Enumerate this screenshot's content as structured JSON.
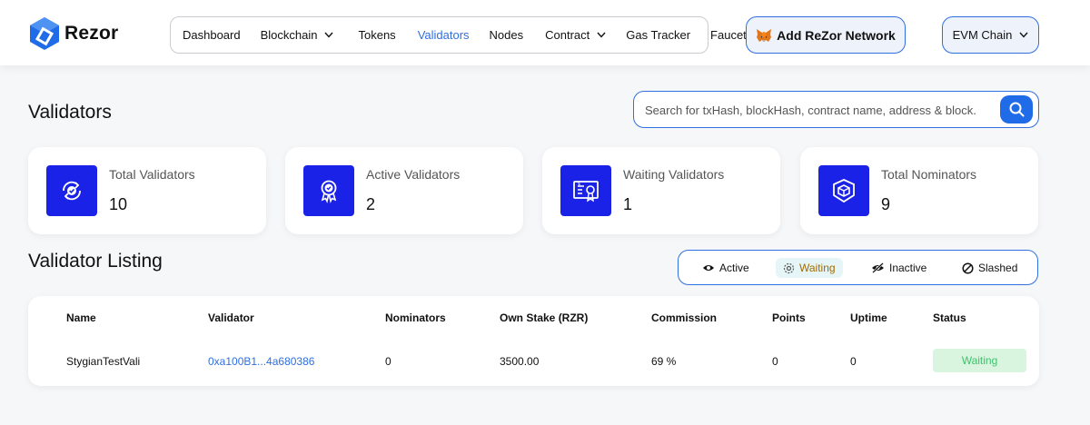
{
  "app": {
    "logo_text": "Rezor",
    "brand_color": "#1a22e8",
    "accent_color": "#2f6fe0"
  },
  "nav": {
    "items": [
      {
        "label": "Dashboard",
        "has_dropdown": false,
        "active": false
      },
      {
        "label": "Blockchain",
        "has_dropdown": true,
        "active": false
      },
      {
        "label": "Tokens",
        "has_dropdown": false,
        "active": false
      },
      {
        "label": "Validators",
        "has_dropdown": false,
        "active": true
      },
      {
        "label": "Nodes",
        "has_dropdown": false,
        "active": false
      },
      {
        "label": "Contract",
        "has_dropdown": true,
        "active": false
      },
      {
        "label": "Gas Tracker",
        "has_dropdown": false,
        "active": false
      },
      {
        "label": "Faucet",
        "has_dropdown": false,
        "active": false
      }
    ],
    "add_network_label": "Add ReZor Network",
    "chain_select": "EVM Chain"
  },
  "page": {
    "title": "Validators"
  },
  "search": {
    "placeholder": "Search for txHash, blockHash, contract name, address & block.",
    "icon": "search-icon"
  },
  "stats": [
    {
      "label": "Total Validators",
      "value": "10",
      "icon": "refresh-check-icon"
    },
    {
      "label": "Active Validators",
      "value": "2",
      "icon": "award-badge-icon"
    },
    {
      "label": "Waiting Validators",
      "value": "1",
      "icon": "certificate-icon"
    },
    {
      "label": "Total Nominators",
      "value": "9",
      "icon": "cube-shield-icon"
    }
  ],
  "listing": {
    "title": "Validator Listing",
    "filters": [
      {
        "label": "Active",
        "icon": "eye-icon",
        "selected": false
      },
      {
        "label": "Waiting",
        "icon": "target-icon",
        "selected": true
      },
      {
        "label": "Inactive",
        "icon": "eye-off-icon",
        "selected": false
      },
      {
        "label": "Slashed",
        "icon": "ban-icon",
        "selected": false
      }
    ],
    "columns": [
      "Name",
      "Validator",
      "Nominators",
      "Own Stake (RZR)",
      "Commission",
      "Points",
      "Uptime",
      "Status"
    ],
    "rows": [
      {
        "name": "StygianTestVali",
        "validator": "0xa100B1...4a680386",
        "nominators": "0",
        "own_stake": "3500.00",
        "commission": "69 %",
        "points": "0",
        "uptime": "0",
        "status": "Waiting"
      }
    ]
  }
}
